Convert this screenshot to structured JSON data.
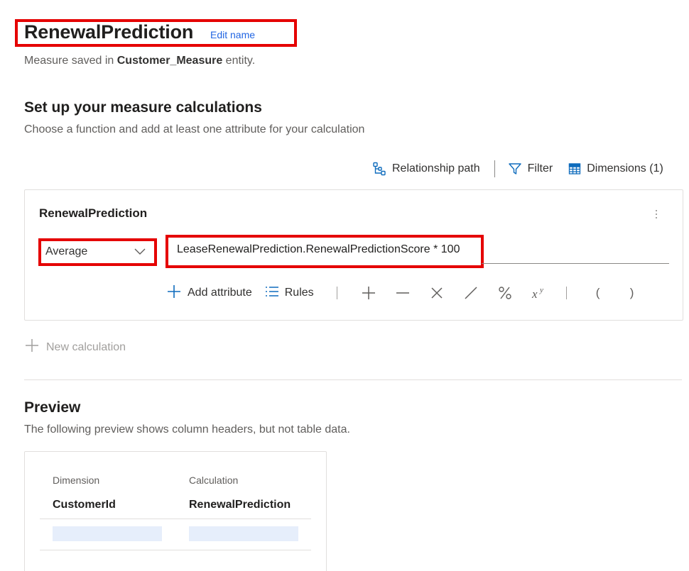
{
  "header": {
    "title": "RenewalPrediction",
    "edit_name": "Edit name",
    "subtitle_prefix": "Measure saved in ",
    "subtitle_entity": "Customer_Measure",
    "subtitle_suffix": " entity."
  },
  "setup": {
    "title": "Set up your measure calculations",
    "subtitle": "Choose a function and add at least one attribute for your calculation"
  },
  "toolbar": {
    "relationship_path": "Relationship path",
    "filter": "Filter",
    "dimensions": "Dimensions (1)"
  },
  "calculation": {
    "name": "RenewalPrediction",
    "function": "Average",
    "formula": "LeaseRenewalPrediction.RenewalPredictionScore * 100",
    "add_attribute": "Add attribute",
    "rules": "Rules",
    "operators": [
      "+",
      "−",
      "×",
      "/",
      "%",
      "x^y"
    ],
    "open_paren": "(",
    "close_paren": ")"
  },
  "new_calculation": "New calculation",
  "preview": {
    "title": "Preview",
    "subtitle": "The following preview shows column headers, but not table data.",
    "columns": [
      {
        "header": "Dimension",
        "value": "CustomerId"
      },
      {
        "header": "Calculation",
        "value": "RenewalPrediction"
      }
    ]
  },
  "colors": {
    "accent": "#2266e3",
    "highlight_border": "#e50000",
    "placeholder_fill": "#e6eefb"
  }
}
